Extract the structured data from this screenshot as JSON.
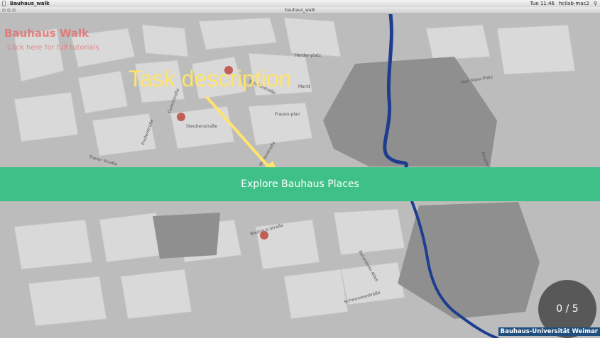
{
  "menubar": {
    "app_name": "Bauhaus_walk",
    "clock": "Tue 11:46",
    "user": "hcilab-mac2"
  },
  "window": {
    "title": "bauhaus_walk"
  },
  "app": {
    "title": "Bauhaus Walk",
    "subtitle": "Click here for full tutorials"
  },
  "annotation": {
    "text": "Task description"
  },
  "task": {
    "label": "Explore Bauhaus Places"
  },
  "progress": {
    "text": "0 / 5",
    "current": 0,
    "total": 5
  },
  "footer": {
    "badge": "Bauhaus-Universität Weimar"
  },
  "map": {
    "street_labels": [
      "Herder-platz",
      "Markt",
      "Schillerstraße",
      "Frauen-plan",
      "Steubenstraße",
      "Geleitstraße",
      "Prellerstraße",
      "Bauhaus-Straße",
      "Belvederer Allee",
      "Schwanseestraße",
      "Trierer Straße",
      "Marienstraße",
      "Karl-Marx-Platz",
      "Amalienstraße"
    ],
    "markers": 3
  },
  "colors": {
    "banner": "#3ec088",
    "marker": "#c15f56",
    "river": "#1e3d8f",
    "annotation": "#ffe36b",
    "badge": "#1f4f7f"
  }
}
